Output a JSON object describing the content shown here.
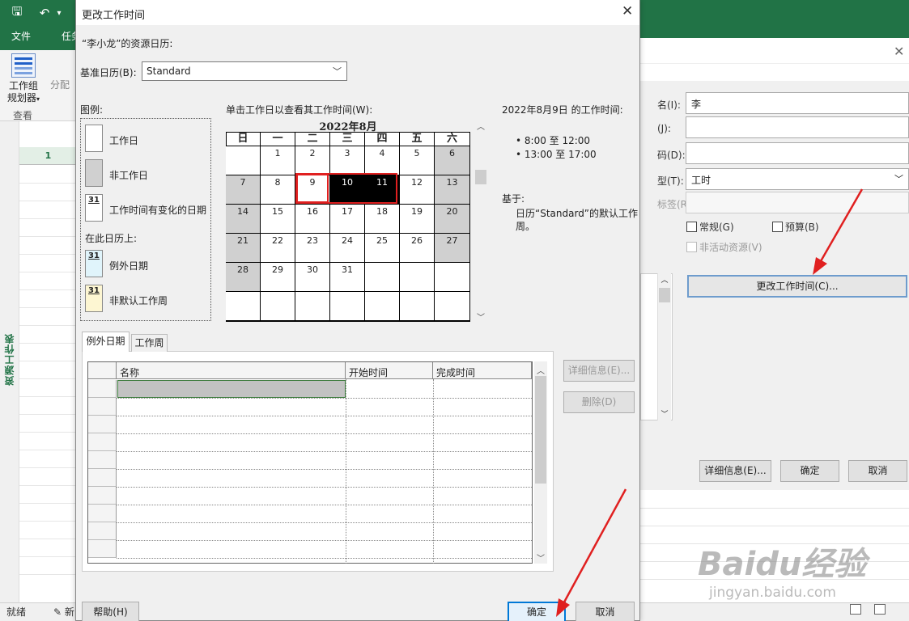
{
  "app": {
    "file_tab": "文件",
    "task_tab": "任务",
    "planner_label_1": "工作组",
    "planner_label_2": "规划器",
    "planner_caret": "▾",
    "assign_label": "分配",
    "view_group": "查看",
    "vertical_label": "资源工作表",
    "row_number": "1",
    "status_ready": "就绪",
    "status_new": "新",
    "save_glyph": "🖫",
    "undo_glyph": "↶",
    "qat_caret": "▾"
  },
  "resource_dialog": {
    "labels": [
      "名(I):",
      "(J):",
      "码(D):",
      "型(T):",
      "标签(R):"
    ],
    "name_value": "李",
    "type_value": "工时",
    "chk_general": "常规(G)",
    "chk_budget": "预算(B)",
    "chk_inactive": "非活动资源(V)",
    "change_button": "更改工作时间(C)...",
    "details_button": "详细信息(E)...",
    "ok_button": "确定",
    "cancel_button": "取消",
    "close_glyph": "✕"
  },
  "dialog": {
    "title": "更改工作时间",
    "close_glyph": "✕",
    "resource_calendar_label": "“李小龙”的资源日历:",
    "base_calendar_label": "基准日历(B):",
    "base_calendar_value": "Standard",
    "legend": {
      "title": "图例:",
      "working": "工作日",
      "nonworking": "非工作日",
      "changed": "工作时间有变化的日期",
      "on_this_calendar": "在此日历上:",
      "exception": "例外日期",
      "nondefault_week": "非默认工作周",
      "swatch_day": "31"
    },
    "calendar": {
      "instruction": "单击工作日以查看其工作时间(W):",
      "month_title": "2022年8月",
      "weekdays": [
        "日",
        "一",
        "二",
        "三",
        "四",
        "五",
        "六"
      ],
      "days": [
        "",
        "1",
        "2",
        "3",
        "4",
        "5",
        "6",
        "7",
        "8",
        "9",
        "10",
        "11",
        "12",
        "13",
        "14",
        "15",
        "16",
        "17",
        "18",
        "19",
        "20",
        "21",
        "22",
        "23",
        "24",
        "25",
        "26",
        "27",
        "28",
        "29",
        "30",
        "31",
        "",
        "",
        "",
        "",
        "",
        "",
        "",
        "",
        "",
        ""
      ]
    },
    "working_times": {
      "title": "2022年8月9日 的工作时间:",
      "slot_1": "• 8:00 至 12:00",
      "slot_2": "• 13:00 至 17:00",
      "basis_label": "基于:",
      "basis_text": "日历“Standard”的默认工作周。"
    },
    "tabs": [
      "例外日期",
      "工作周"
    ],
    "table": {
      "columns": [
        "名称",
        "开始时间",
        "完成时间"
      ]
    },
    "details_button": "详细信息(E)...",
    "delete_button": "删除(D)",
    "help_button": "帮助(H)",
    "ok_button": "确定",
    "cancel_button": "取消"
  },
  "watermark": {
    "main": "Baidu经验",
    "sub": "jingyan.baidu.com"
  },
  "colors": {
    "ribbon_green": "#217346",
    "annotation_red": "#e02020",
    "ok_border": "#0078d7"
  }
}
